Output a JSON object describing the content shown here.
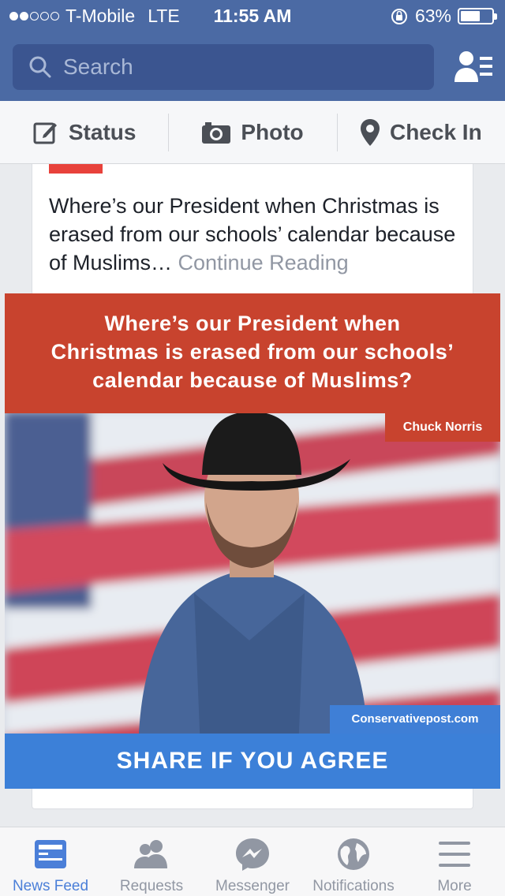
{
  "status_bar": {
    "carrier": "T-Mobile",
    "network": "LTE",
    "time": "11:55 AM",
    "battery": "63%",
    "battery_level": 0.63
  },
  "header": {
    "search_placeholder": "Search"
  },
  "composer": {
    "status_label": "Status",
    "photo_label": "Photo",
    "checkin_label": "Check In"
  },
  "post": {
    "text": "Where’s our President when Christmas is erased from our schools’ calendar because of Muslims…",
    "continue_label": "Continue Reading",
    "image": {
      "headline_1": "Where’s our President when",
      "headline_2": "Christmas is erased from our schools’",
      "headline_3": "calendar because of Muslims?",
      "name_label": "Chuck Norris",
      "site_label": "Conservativepost.com",
      "cta": "SHARE IF YOU AGREE"
    }
  },
  "tabbar": {
    "items": [
      {
        "label": "News Feed",
        "icon": "news-feed-icon",
        "active": true
      },
      {
        "label": "Requests",
        "icon": "friend-requests-icon"
      },
      {
        "label": "Messenger",
        "icon": "messenger-icon"
      },
      {
        "label": "Notifications",
        "icon": "globe-icon"
      },
      {
        "label": "More",
        "icon": "menu-icon"
      }
    ]
  },
  "colors": {
    "brand_blue": "#4b6aa4",
    "headline_red": "#c8432e",
    "cta_blue": "#3c80d8",
    "active_tab": "#4b7fd8"
  }
}
